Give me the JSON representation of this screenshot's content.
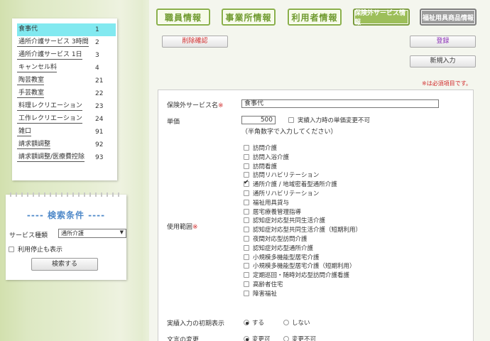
{
  "tabs": [
    {
      "label": "職員情報",
      "active": false
    },
    {
      "label": "事業所情報",
      "active": false
    },
    {
      "label": "利用者情報",
      "active": false
    },
    {
      "label": "保険外サービス情報",
      "active": true
    },
    {
      "label": "福祉用具商品情報",
      "active": false
    }
  ],
  "service_list": [
    {
      "name": "食事代",
      "num": "1",
      "selected": true
    },
    {
      "name": "通所介護サービス 3時間",
      "num": "2"
    },
    {
      "name": "通所介護サービス 1日",
      "num": "3"
    },
    {
      "name": "キャンセル料",
      "num": "4"
    },
    {
      "name": "陶芸教室",
      "num": "21"
    },
    {
      "name": "手芸教室",
      "num": "22"
    },
    {
      "name": "料理レクリエーション",
      "num": "23"
    },
    {
      "name": "工作レクリエーション",
      "num": "24"
    },
    {
      "name": "雑口",
      "num": "91"
    },
    {
      "name": "請求額調整",
      "num": "92"
    },
    {
      "name": "請求額調整/医療費控除",
      "num": "93"
    }
  ],
  "search": {
    "title": "---- 検索条件 ----",
    "service_type_label": "サービス種類",
    "service_type_value": "通所介護",
    "show_stopped_label": "利用停止も表示",
    "search_button": "検索する"
  },
  "actions": {
    "delete_confirm": "削除確認",
    "register": "登録",
    "new_entry": "新規入力",
    "required_note": "※は必須項目です。"
  },
  "form": {
    "service_name_label": "保険外サービス名",
    "service_name_value": "食事代",
    "unit_price_label": "単価",
    "unit_price_value": "500",
    "allow_change_label": "実績入力時の単価変更不可",
    "half_width_note": "（半角数字で入力してください）",
    "scope_label": "使用範囲",
    "required_mark": "※",
    "scope_options": [
      {
        "label": "訪問介護",
        "checked": false
      },
      {
        "label": "訪問入浴介護",
        "checked": false
      },
      {
        "label": "訪問看護",
        "checked": false
      },
      {
        "label": "訪問リハビリテーション",
        "checked": false
      },
      {
        "label": "通所介護 / 地域密着型通所介護",
        "checked": true
      },
      {
        "label": "通所リハビリテーション",
        "checked": false
      },
      {
        "label": "福祉用具貸与",
        "checked": false
      },
      {
        "label": "居宅療養管理指導",
        "checked": false
      },
      {
        "label": "認知症対応型共同生活介護",
        "checked": false
      },
      {
        "label": "認知症対応型共同生活介護（短期利用）",
        "checked": false
      },
      {
        "label": "夜間対応型訪問介護",
        "checked": false
      },
      {
        "label": "認知症対応型通所介護",
        "checked": false
      },
      {
        "label": "小規模多機能型居宅介護",
        "checked": false
      },
      {
        "label": "小規模多機能型居宅介護（短期利用）",
        "checked": false
      },
      {
        "label": "定期巡回・随時対応型訪問介護看護",
        "checked": false
      },
      {
        "label": "高齢者住宅",
        "checked": false
      },
      {
        "label": "障害福祉",
        "checked": false
      }
    ],
    "initial_display_label": "実績入力の初期表示",
    "initial_display_options": [
      {
        "label": "する",
        "selected": true
      },
      {
        "label": "しない",
        "selected": false
      }
    ],
    "text_change_label": "文言の変更",
    "text_change_options": [
      {
        "label": "変更可",
        "selected": true
      },
      {
        "label": "変更不可",
        "selected": false
      }
    ]
  }
}
